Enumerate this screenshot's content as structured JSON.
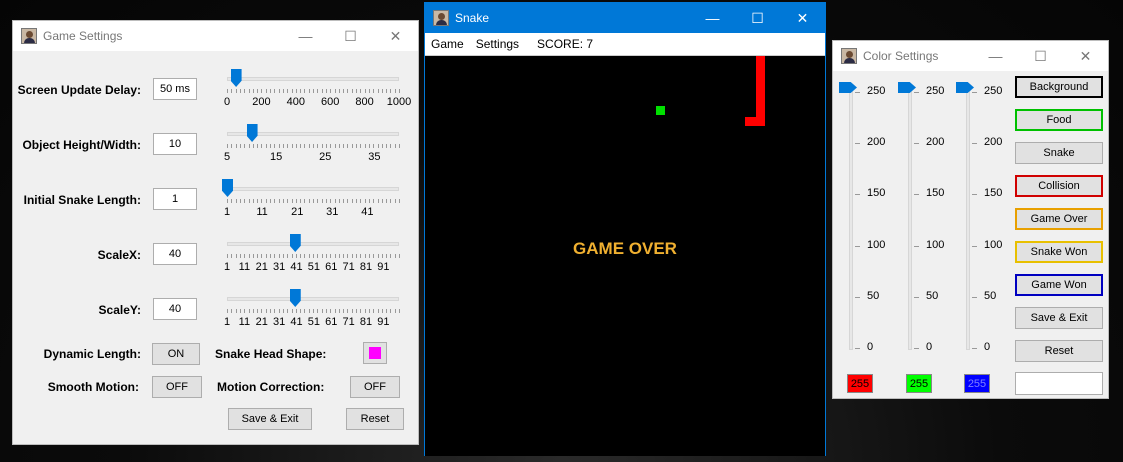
{
  "game_settings": {
    "title": "Game Settings",
    "rows": [
      {
        "label": "Screen Update Delay:",
        "value": "50 ms",
        "ticks": [
          "0",
          "200",
          "400",
          "600",
          "800",
          "1000"
        ],
        "slider_value": 50,
        "min": 0,
        "max": 1000
      },
      {
        "label": "Object Height/Width:",
        "value": "10",
        "ticks": [
          "5",
          "15",
          "25",
          "35"
        ],
        "slider_value": 10,
        "min": 5,
        "max": 40
      },
      {
        "label": "Initial Snake Length:",
        "value": "1",
        "ticks": [
          "1",
          "11",
          "21",
          "31",
          "41"
        ],
        "slider_value": 1,
        "min": 1,
        "max": 50
      },
      {
        "label": "ScaleX:",
        "value": "40",
        "ticks": [
          "1",
          "11",
          "21",
          "31",
          "41",
          "51",
          "61",
          "71",
          "81",
          "91"
        ],
        "slider_value": 40,
        "min": 1,
        "max": 100
      },
      {
        "label": "ScaleY:",
        "value": "40",
        "ticks": [
          "1",
          "11",
          "21",
          "31",
          "41",
          "51",
          "61",
          "71",
          "81",
          "91"
        ],
        "slider_value": 40,
        "min": 1,
        "max": 100
      }
    ],
    "dynamic_length_label": "Dynamic Length:",
    "dynamic_length_value": "ON",
    "snake_head_shape_label": "Snake Head Shape:",
    "snake_head_color": "#ff00ff",
    "smooth_motion_label": "Smooth Motion:",
    "smooth_motion_value": "OFF",
    "motion_correction_label": "Motion Correction:",
    "motion_correction_value": "OFF",
    "save_exit_label": "Save & Exit",
    "reset_label": "Reset"
  },
  "snake": {
    "title": "Snake",
    "menu": [
      "Game",
      "Settings"
    ],
    "score_text": "SCORE: 7",
    "game_over_text": "GAME OVER",
    "game_over_color": "#f0b030",
    "food_color": "#00e000",
    "snake_color": "#ff0000"
  },
  "color_settings": {
    "title": "Color Settings",
    "scale_labels": [
      "250",
      "200",
      "150",
      "100",
      "50",
      "0"
    ],
    "channels": [
      {
        "value": "255",
        "color": "#ff0000"
      },
      {
        "value": "255",
        "color": "#00ff00"
      },
      {
        "value": "255",
        "color": "#0000ff"
      }
    ],
    "buttons": [
      {
        "label": "Background",
        "border": "#000000"
      },
      {
        "label": "Food",
        "border": "#00c000"
      },
      {
        "label": "Snake",
        "border": "#adadad"
      },
      {
        "label": "Collision",
        "border": "#d00000"
      },
      {
        "label": "Game Over",
        "border": "#e8a000"
      },
      {
        "label": "Snake Won",
        "border": "#e8c000"
      },
      {
        "label": "Game Won",
        "border": "#0000c0"
      },
      {
        "label": "Save & Exit",
        "border": "#adadad"
      },
      {
        "label": "Reset",
        "border": "#adadad"
      }
    ],
    "preview_color": "#ffffff"
  }
}
